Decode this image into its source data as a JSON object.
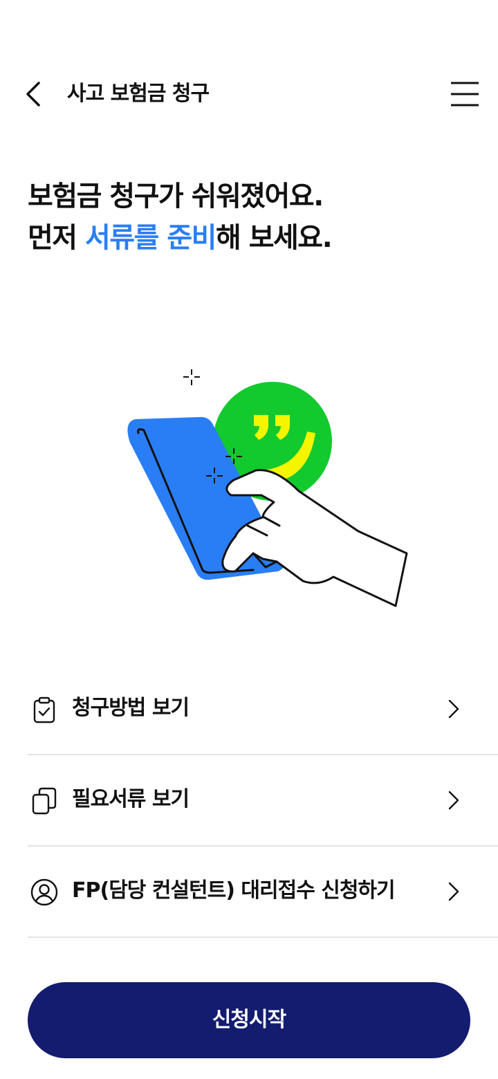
{
  "header": {
    "title": "사고 보험금 청구",
    "back_icon": "chevron-left-icon",
    "menu_icon": "hamburger-menu-icon"
  },
  "headline": {
    "line1": "보험금 청구가 쉬워졌어요.",
    "line2_prefix": "먼저 ",
    "line2_accent": "서류를 준비",
    "line2_suffix": "해 보세요."
  },
  "menu": [
    {
      "label": "청구방법 보기",
      "icon": "clipboard-check-icon"
    },
    {
      "label": "필요서류 보기",
      "icon": "documents-icon"
    },
    {
      "label": "FP(담당 컨설턴트) 대리접수 신청하기",
      "icon": "user-circle-icon"
    }
  ],
  "cta": {
    "label": "신청시작"
  },
  "colors": {
    "accent": "#2a7ef5",
    "primary_button": "#131c6f",
    "phone": "#2a7ef5",
    "circle": "#12c92e",
    "quote": "#f5f500"
  }
}
